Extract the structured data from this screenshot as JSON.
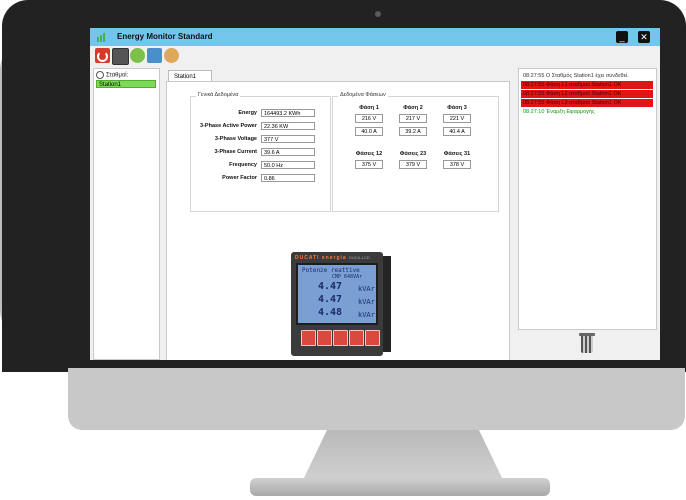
{
  "window": {
    "title": "Energy Monitor Standard",
    "minimize": "_",
    "close": "✕"
  },
  "toolbar": {
    "icons": [
      "power-icon",
      "meter-icon",
      "gear-icon",
      "database-icon",
      "user-icon"
    ]
  },
  "tree": {
    "root_label": "Σταθμοί:",
    "station": "Station1"
  },
  "tab": {
    "label": "Station1"
  },
  "general": {
    "title": "Γενικά Δεδομένα",
    "rows": [
      {
        "label": "Energy",
        "value": "164493.2 KWh"
      },
      {
        "label": "3-Phase Active Power",
        "value": "22.36 KW"
      },
      {
        "label": "3-Phase Voltage",
        "value": "377 V"
      },
      {
        "label": "3-Phase Current",
        "value": "39.6 A"
      },
      {
        "label": "Frequency",
        "value": "50.0 Hz"
      },
      {
        "label": "Power Factor",
        "value": "0.86"
      }
    ]
  },
  "phases": {
    "title": "Δεδομένα Φάσεων",
    "cols": [
      {
        "label": "Φάση 1",
        "voltage": "216 V",
        "current": "40.0 A"
      },
      {
        "label": "Φάση 2",
        "voltage": "217 V",
        "current": "39.2 A"
      },
      {
        "label": "Φάση 3",
        "voltage": "221 V",
        "current": "40.4 A"
      }
    ],
    "line": [
      {
        "label": "Φάσεις 12",
        "value": "375 V"
      },
      {
        "label": "Φάσεις 23",
        "value": "379 V"
      },
      {
        "label": "Φάσεις 31",
        "value": "378 V"
      }
    ]
  },
  "device": {
    "brand": "DUCATI energia",
    "model": "DUCA-LCD",
    "lcd_header": "Potenze reattive",
    "lcd_subheader": "CMP 648VAr",
    "readings": [
      {
        "value": "4.47",
        "unit": "kVAr"
      },
      {
        "value": "4.47",
        "unit": "kVAr"
      },
      {
        "value": "4.48",
        "unit": "kVAr"
      }
    ]
  },
  "log": [
    {
      "type": "info",
      "text": "08:27:55 Ο Σταθμός Station1 έχει συνδεθεί."
    },
    {
      "type": "err",
      "text": "08:27:55 Φάση L1 σταθμού Station1 OK"
    },
    {
      "type": "err",
      "text": "08:27:55 Φάση L2 σταθμού Station1 OK"
    },
    {
      "type": "err",
      "text": "08:27:55 Φάση L3 σταθμού Station1 OK"
    },
    {
      "type": "ok",
      "text": "08:27:10 Έναρξη Εφαρμογής"
    }
  ],
  "colors": {
    "titlebar": "#74c5ec",
    "error_row": "#e01414",
    "ok_text": "#1e8a1e",
    "station_highlight": "#7ed957"
  }
}
